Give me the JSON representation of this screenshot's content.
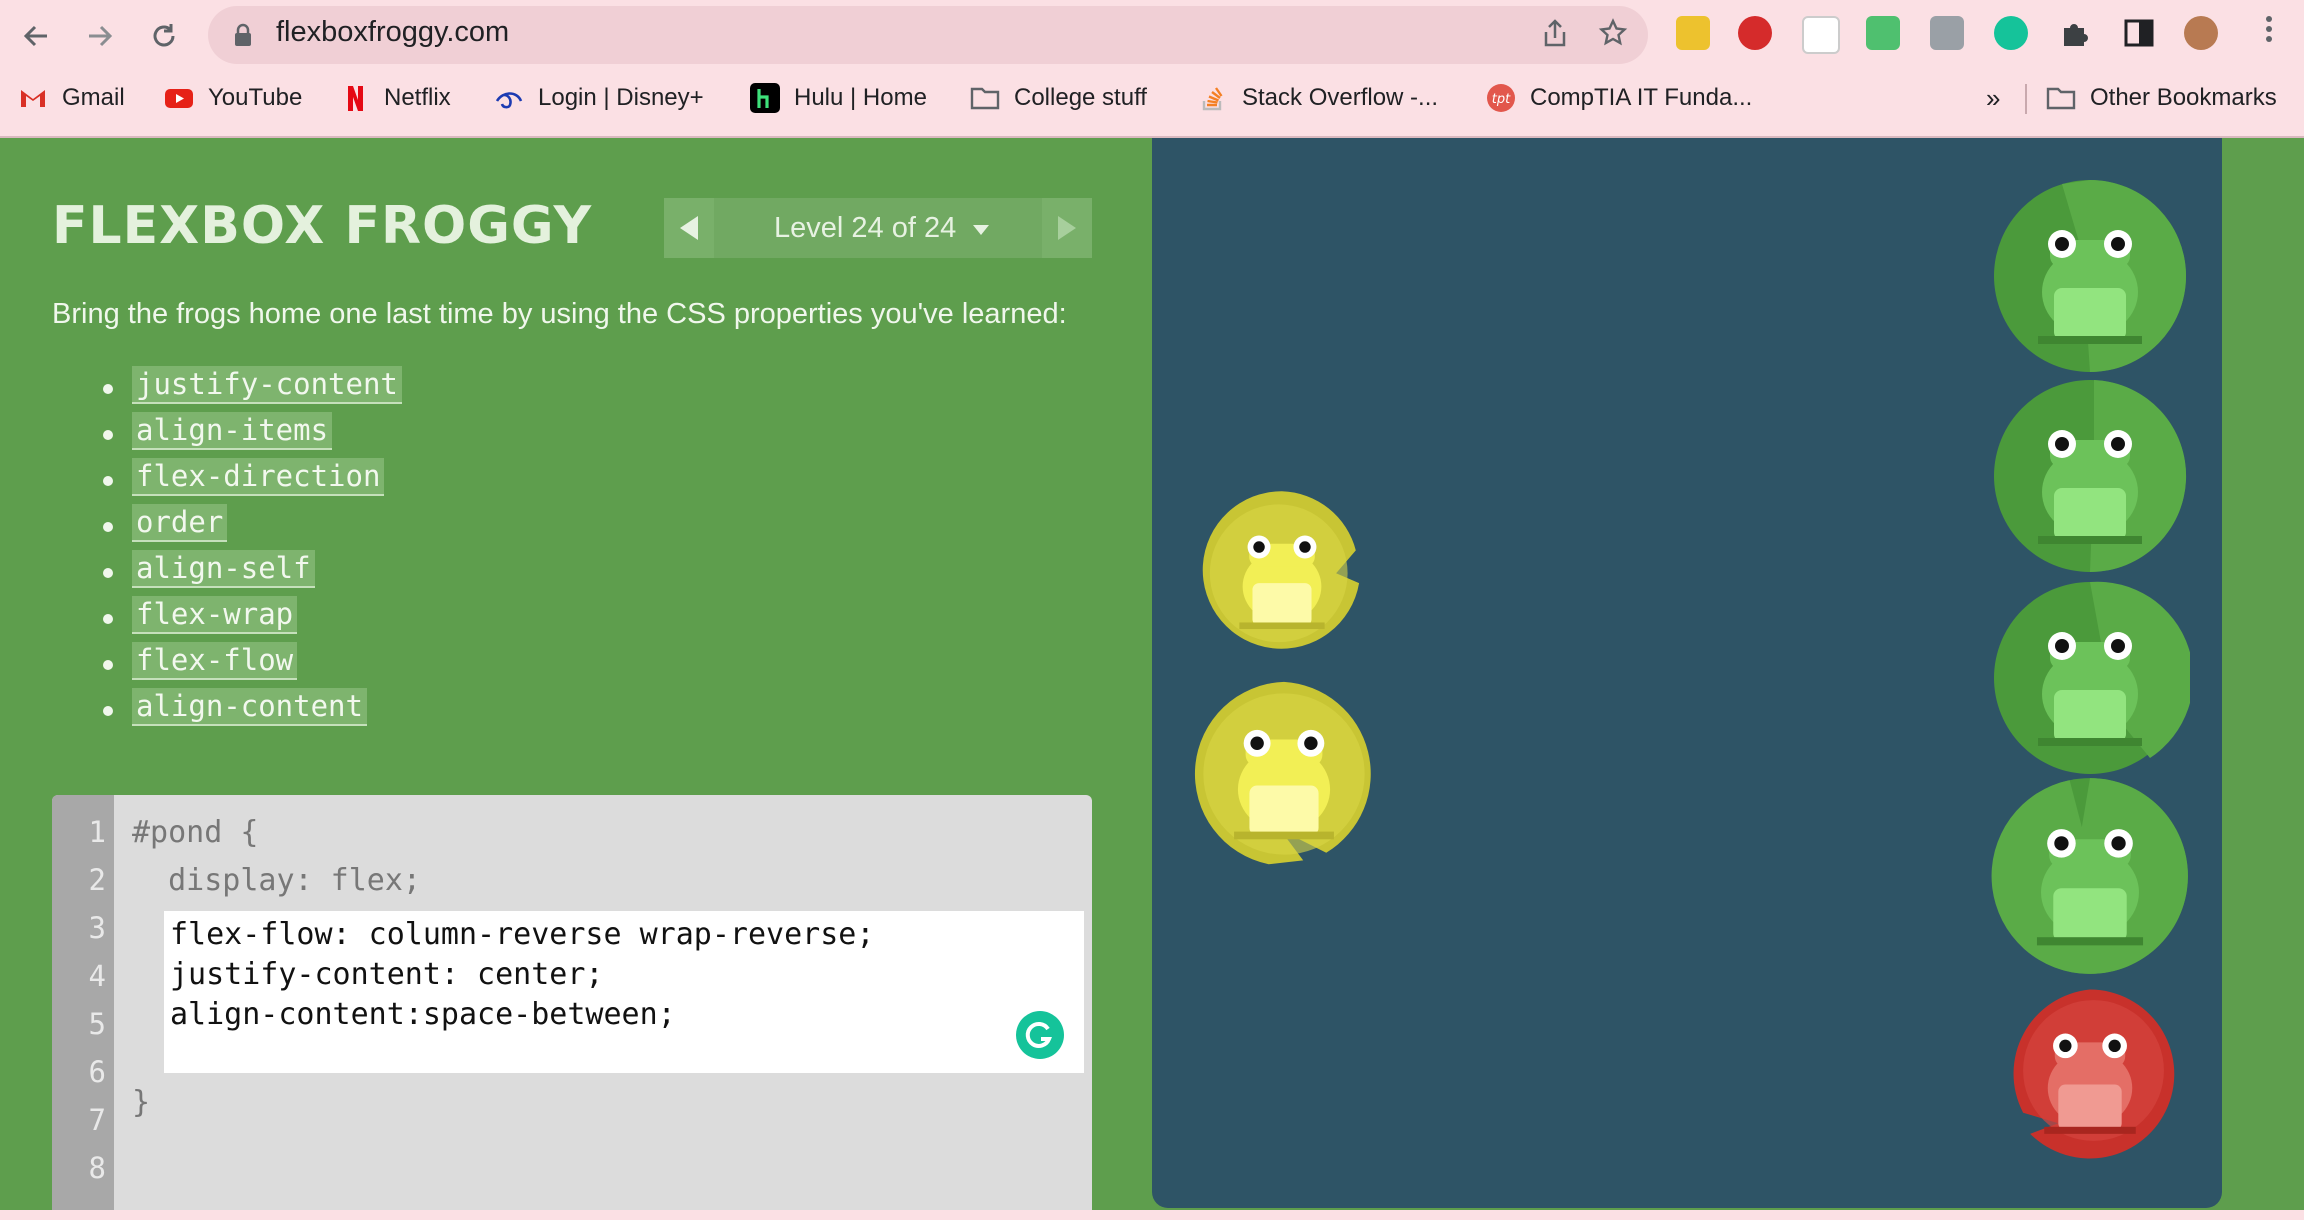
{
  "browser": {
    "url": "flexboxfroggy.com",
    "bookmarks": [
      {
        "label": "Gmail",
        "icon": "gmail-icon",
        "color": "#d93025"
      },
      {
        "label": "YouTube",
        "icon": "youtube-icon",
        "color": "#e62117"
      },
      {
        "label": "Netflix",
        "icon": "netflix-icon",
        "color": "#e50914"
      },
      {
        "label": "Login | Disney+",
        "icon": "disney-plus-icon",
        "color": "#1d3bb2"
      },
      {
        "label": "Hulu | Home",
        "icon": "hulu-icon",
        "color": "#000000"
      },
      {
        "label": "College stuff",
        "icon": "folder-icon",
        "color": "#5f6368"
      },
      {
        "label": "Stack Overflow -...",
        "icon": "stackoverflow-icon",
        "color": "#f48024"
      },
      {
        "label": "CompTIA IT Funda...",
        "icon": "comptia-icon",
        "color": "#e2574c"
      }
    ],
    "more_bookmarks": "»",
    "other_bookmarks": "Other Bookmarks",
    "extensions": [
      "2048-icon",
      "adblock-plus-icon",
      "extension-icon",
      "extension-icon",
      "extension-icon",
      "grammarly-icon",
      "puzzle-icon",
      "side-panel-icon",
      "profile-avatar"
    ]
  },
  "game": {
    "title": "FLEXBOX FROGGY",
    "level_label": "Level 24 of 24",
    "instructions": "Bring the frogs home one last time by using the CSS properties you've learned:",
    "properties": [
      "justify-content",
      "align-items",
      "flex-direction",
      "order",
      "align-self",
      "flex-wrap",
      "flex-flow",
      "align-content"
    ]
  },
  "editor": {
    "line_numbers": [
      "1",
      "2",
      "3",
      "4",
      "5",
      "6",
      "7",
      "8"
    ],
    "line1": "#pond {",
    "line2": "  display: flex;",
    "input_lines": [
      "flex-flow: column-reverse wrap-reverse;",
      "justify-content: center;",
      "align-content:space-between;"
    ],
    "closing": "}"
  },
  "pond": {
    "frogs_placed": [
      "yellow",
      "yellow"
    ],
    "lilypads": [
      "green",
      "green",
      "green",
      "green",
      "red"
    ],
    "colors": {
      "pond": "#2e5466",
      "green": "#4b9a3b",
      "yellow": "#d2d23c",
      "red": "#c8312b"
    }
  }
}
